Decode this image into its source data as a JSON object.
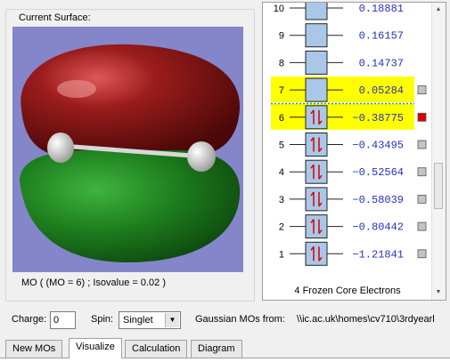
{
  "surface_panel": {
    "title": "Current Surface:",
    "caption": "MO ( (MO = 6) ; Isovalue = 0.02 )",
    "colors": {
      "background": "#8585c9",
      "lobe_top": "#8b1515",
      "lobe_bottom": "#1e7f1e",
      "atom": "#f2f2f2"
    }
  },
  "diagram": {
    "levels": [
      {
        "index": "10",
        "energy": "0.18881",
        "occupied": false,
        "highlight": false,
        "marker": ""
      },
      {
        "index": "9",
        "energy": "0.16157",
        "occupied": false,
        "highlight": false,
        "marker": ""
      },
      {
        "index": "8",
        "energy": "0.14737",
        "occupied": false,
        "highlight": false,
        "marker": ""
      },
      {
        "index": "7",
        "energy": "0.05284",
        "occupied": false,
        "highlight": true,
        "marker": "grey"
      },
      {
        "index": "6",
        "energy": "−0.38775",
        "occupied": true,
        "highlight": true,
        "marker": "red"
      },
      {
        "index": "5",
        "energy": "−0.43495",
        "occupied": true,
        "highlight": false,
        "marker": "grey"
      },
      {
        "index": "4",
        "energy": "−0.52564",
        "occupied": true,
        "highlight": false,
        "marker": "grey"
      },
      {
        "index": "3",
        "energy": "−0.58039",
        "occupied": true,
        "highlight": false,
        "marker": "grey"
      },
      {
        "index": "2",
        "energy": "−0.80442",
        "occupied": true,
        "highlight": false,
        "marker": "grey"
      },
      {
        "index": "1",
        "energy": "−1.21841",
        "occupied": true,
        "highlight": false,
        "marker": "grey"
      }
    ],
    "footer": "4 Frozen Core Electrons",
    "colors": {
      "highlight": "#ffff00",
      "box": "#a9c8e8",
      "arrows": "#dd0000",
      "energy_text": "#2233bb",
      "marker_red": "#dd0000",
      "marker_grey": "#c4c4c4",
      "gap_line": "#1a9a9a"
    }
  },
  "controls": {
    "charge_label": "Charge:",
    "charge_value": "0",
    "spin_label": "Spin:",
    "spin_value": "Singlet",
    "source_label": "Gaussian MOs from:",
    "source_path": "\\\\ic.ac.uk\\homes\\cv710\\3rdyearl"
  },
  "tabs": [
    {
      "label": "New MOs",
      "active": false
    },
    {
      "label": "Visualize",
      "active": true
    },
    {
      "label": "Calculation",
      "active": false
    },
    {
      "label": "Diagram",
      "active": false
    }
  ]
}
